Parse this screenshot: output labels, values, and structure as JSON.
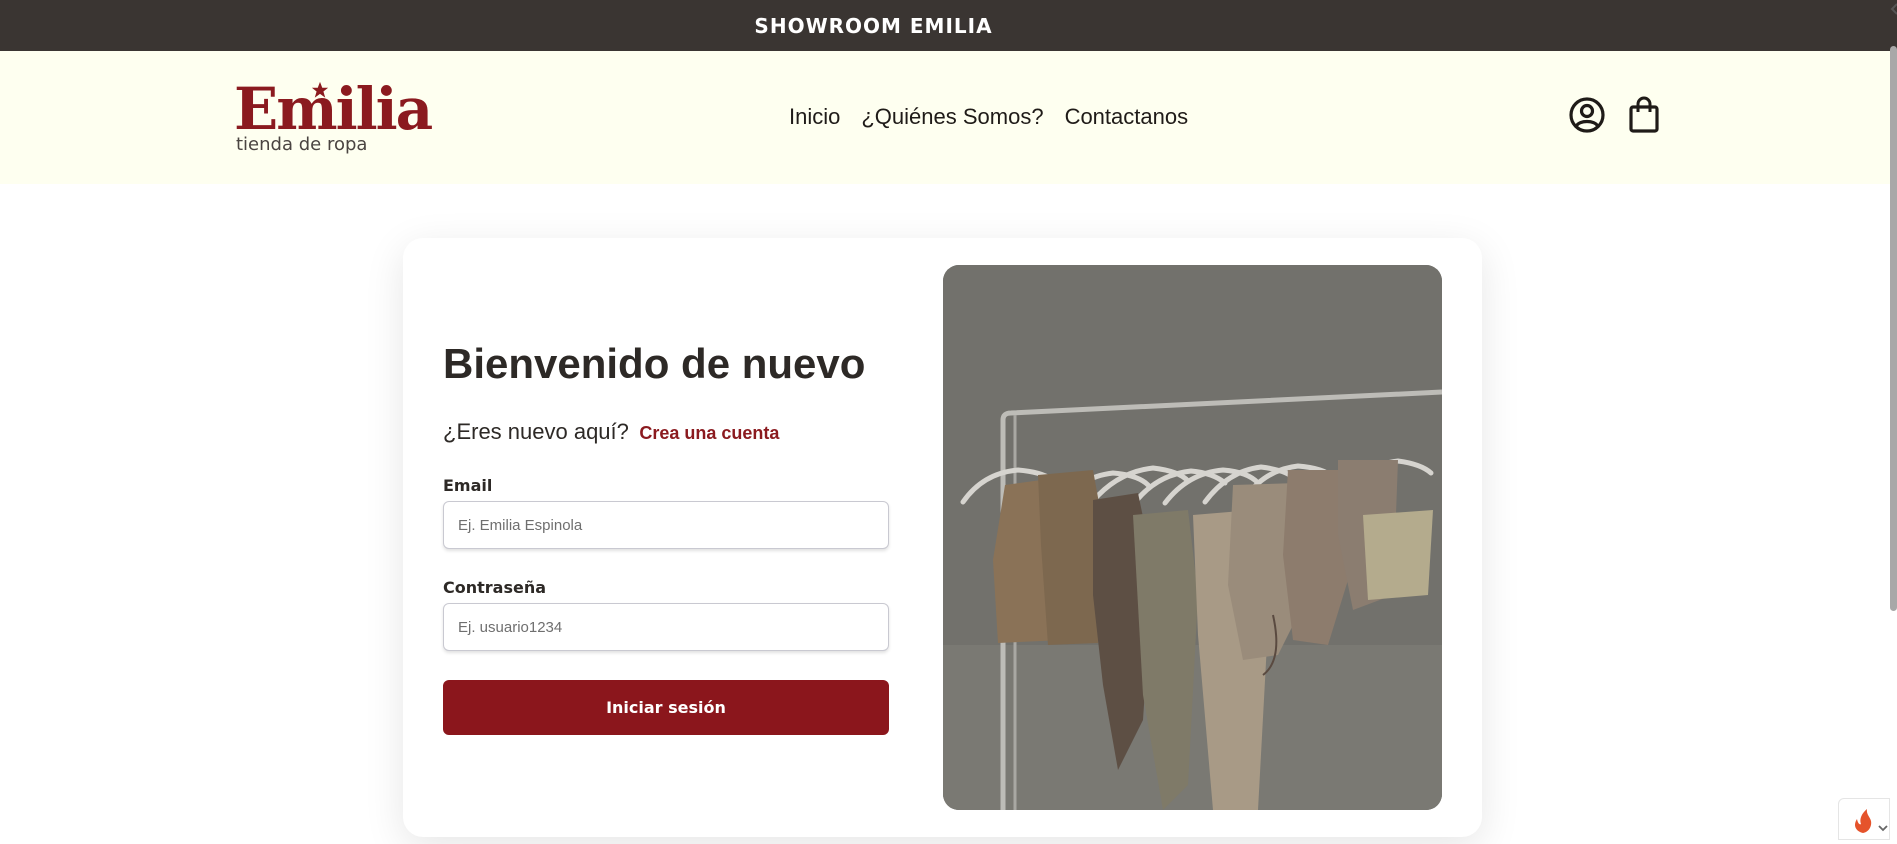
{
  "announcement": {
    "text": "SHOWROOM EMILIA"
  },
  "brand": {
    "name": "Emilia",
    "tagline": "tienda de ropa",
    "color": "#8b1a1f"
  },
  "nav": {
    "items": [
      {
        "label": "Inicio"
      },
      {
        "label": "¿Quiénes Somos?"
      },
      {
        "label": "Contactanos"
      }
    ]
  },
  "header_icons": {
    "account": "user-circle-icon",
    "cart": "shopping-bag-icon"
  },
  "login": {
    "title": "Bienvenido de nuevo",
    "signup_question": "¿Eres nuevo aquí?",
    "signup_link": "Crea una cuenta",
    "email_label": "Email",
    "email_placeholder": "Ej. Emilia Espinola",
    "email_value": "",
    "password_label": "Contraseña",
    "password_placeholder": "Ej. usuario1234",
    "password_value": "",
    "submit_label": "Iniciar sesión",
    "button_color": "#8b161c"
  },
  "corner_widget": {
    "icon": "flame-icon"
  }
}
